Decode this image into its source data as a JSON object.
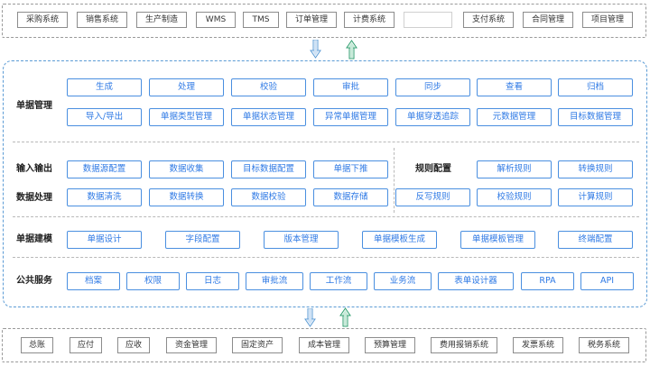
{
  "top_systems": [
    "采购系统",
    "销售系统",
    "生产制造",
    "WMS",
    "TMS",
    "订单管理",
    "计费系统",
    "",
    "支付系统",
    "合同管理",
    "项目管理"
  ],
  "platform": {
    "document_management": {
      "title": "单据管理",
      "row1": [
        "生成",
        "处理",
        "校验",
        "审批",
        "同步",
        "查看",
        "归档"
      ],
      "row2": [
        "导入/导出",
        "单据类型管理",
        "单据状态管理",
        "异常单据管理",
        "单据穿透追踪",
        "元数据管理",
        "目标数据管理"
      ]
    },
    "io": {
      "title": "输入输出",
      "items": [
        "数据源配置",
        "数据收集",
        "目标数据配置",
        "单据下推"
      ]
    },
    "data_processing": {
      "title": "数据处理",
      "items": [
        "数据清洗",
        "数据转换",
        "数据校验",
        "数据存储"
      ]
    },
    "rule_config": {
      "title": "规则配置",
      "row1": [
        "解析规则",
        "转换规则"
      ],
      "row2": [
        "反写规则",
        "校验规则",
        "计算规则"
      ]
    },
    "document_modeling": {
      "title": "单据建模",
      "items": [
        "单据设计",
        "字段配置",
        "版本管理",
        "单据模板生成",
        "单据模板管理",
        "终端配置"
      ]
    },
    "public_services": {
      "title": "公共服务",
      "items": [
        "档案",
        "权限",
        "日志",
        "审批流",
        "工作流",
        "业务流",
        "表单设计器",
        "RPA",
        "API"
      ]
    }
  },
  "bottom_systems": [
    "总账",
    "应付",
    "应收",
    "资金管理",
    "固定资产",
    "成本管理",
    "预算管理",
    "费用报销系统",
    "发票系统",
    "税务系统"
  ],
  "colors": {
    "accent": "#4a8fe0",
    "text_blue": "#2f7ae5",
    "arrow_down": "#5b9bd5",
    "arrow_up": "#2e9e6e"
  },
  "icons": [
    "arrow-down-icon",
    "arrow-up-icon"
  ]
}
